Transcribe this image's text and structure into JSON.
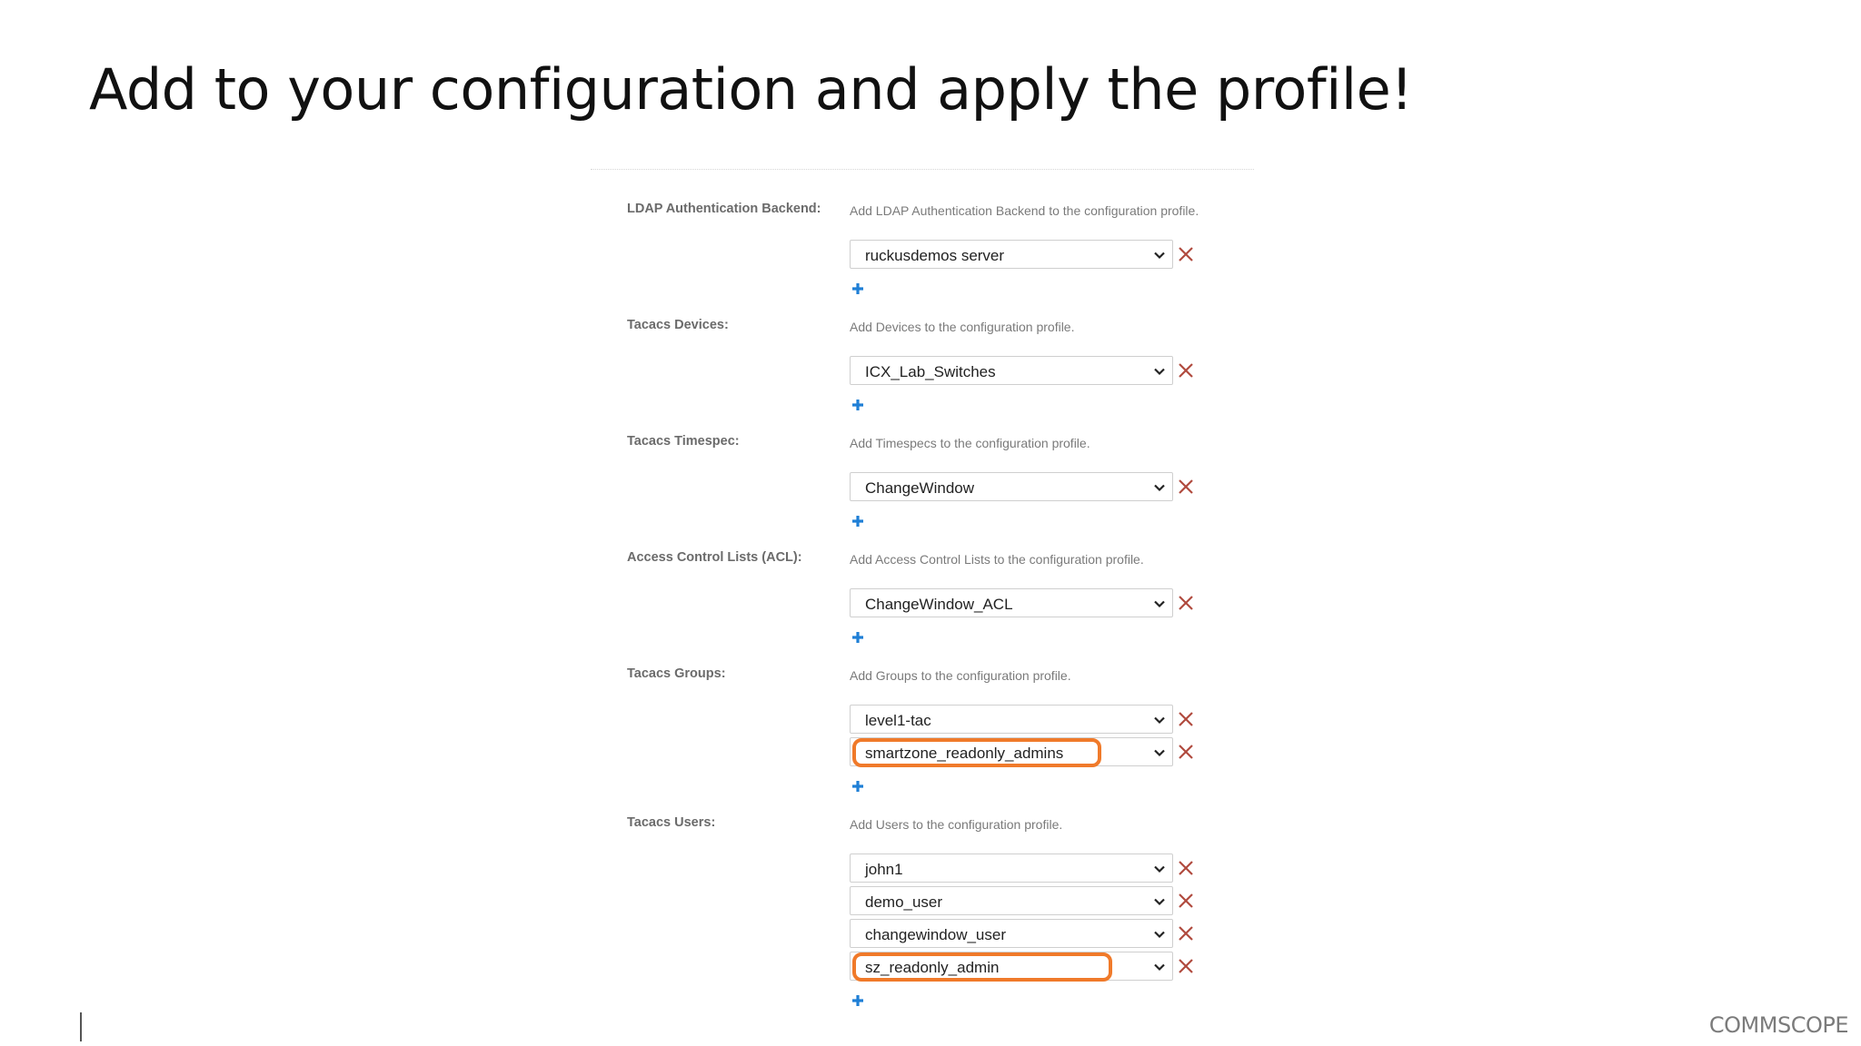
{
  "slide": {
    "title": "Add to your configuration and apply the profile!"
  },
  "form": {
    "sections": {
      "ldap": {
        "label": "LDAP Authentication Backend:",
        "hint": "Add LDAP Authentication Backend to the configuration profile.",
        "values": [
          "ruckusdemos server"
        ]
      },
      "devices": {
        "label": "Tacacs Devices:",
        "hint": "Add Devices to the configuration profile.",
        "values": [
          "ICX_Lab_Switches"
        ]
      },
      "timespec": {
        "label": "Tacacs Timespec:",
        "hint": "Add Timespecs to the configuration profile.",
        "values": [
          "ChangeWindow"
        ]
      },
      "acl": {
        "label": "Access Control Lists (ACL):",
        "hint": "Add Access Control Lists to the configuration profile.",
        "values": [
          "ChangeWindow_ACL"
        ]
      },
      "groups": {
        "label": "Tacacs Groups:",
        "hint": "Add Groups to the configuration profile.",
        "values": [
          "level1-tac",
          "smartzone_readonly_admins"
        ]
      },
      "users": {
        "label": "Tacacs Users:",
        "hint": "Add Users to the configuration profile.",
        "values": [
          "john1",
          "demo_user",
          "changewindow_user",
          "sz_readonly_admin"
        ]
      }
    }
  },
  "icons": {
    "remove": "close-x-icon",
    "add": "plus-icon",
    "dropdown": "chevron-down-icon"
  },
  "colors": {
    "highlight": "#f07a2a",
    "remove": "#b04a3e",
    "add": "#1f7fd6"
  },
  "footer": {
    "logo": "COMMSCOPE"
  }
}
